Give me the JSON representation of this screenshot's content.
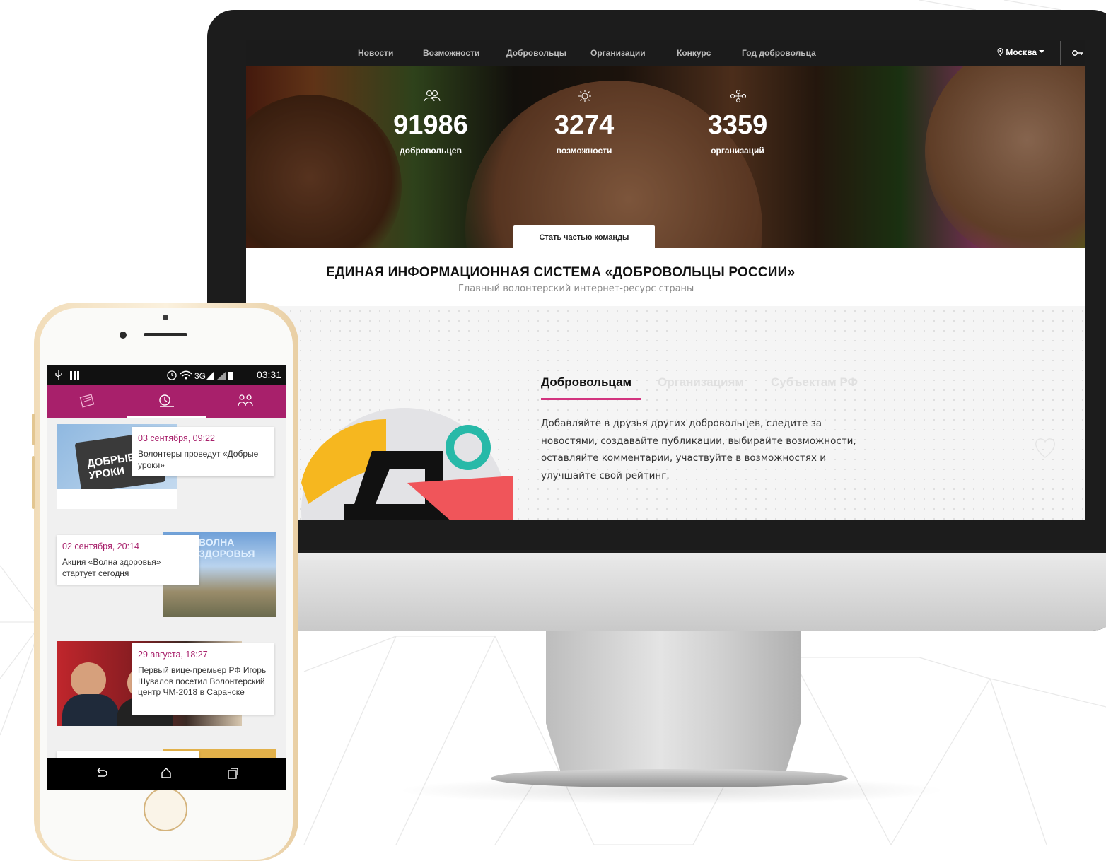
{
  "desktop": {
    "nav": {
      "items": [
        "Новости",
        "Возможности",
        "Добровольцы",
        "Организации",
        "Конкурс",
        "Год добровольца"
      ],
      "city": "Москва",
      "icons": [
        "location-pin-icon",
        "key-icon"
      ]
    },
    "hero": {
      "stats": [
        {
          "value": "91986",
          "label": "добровольцев",
          "icon": "people-icon"
        },
        {
          "value": "3274",
          "label": "возможности",
          "icon": "sun-icon"
        },
        {
          "value": "3359",
          "label": "организаций",
          "icon": "network-icon"
        }
      ],
      "cta": "Стать частью команды"
    },
    "title": "ЕДИНАЯ ИНФОРМАЦИОННАЯ СИСТЕМА «ДОБРОВОЛЬЦЫ РОССИИ»",
    "subtitle": "Главный волонтерский интернет-ресурс страны",
    "tabs": [
      {
        "label": "Добровольцам",
        "active": true
      },
      {
        "label": "Организациям",
        "active": false
      },
      {
        "label": "Субъектам РФ",
        "active": false
      }
    ],
    "description": "Добавляйте в друзья других добровольцев, следите за новостями, создавайте публикации, выбирайте возможности, оставляйте комментарии, участвуйте в возможностях и улучшайте свой рейтинг.",
    "accent_color": "#d2347f"
  },
  "phone": {
    "status": {
      "network": "3G",
      "time": "03:31"
    },
    "tabs": [
      "news-icon",
      "opportunities-icon",
      "people-icon"
    ],
    "accent_color": "#a8206b",
    "news": [
      {
        "date": "03 сентября, 09:22",
        "text": "Волонтеры проведут «Добрые уроки»",
        "image_text": "ДОБРЫЕ УРОКИ"
      },
      {
        "date": "02 сентября, 20:14",
        "text": "Акция «Волна здоровья» стартует сегодня",
        "image_text": "ВОЛНА ЗДОРОВЬЯ"
      },
      {
        "date": "29 августа, 18:27",
        "text": "Первый вице-премьер РФ Игорь Шувалов посетил Волонтерский центр ЧМ-2018 в Саранске",
        "image_text": ""
      }
    ],
    "navbar": [
      "back-icon",
      "home-icon",
      "recents-icon"
    ]
  }
}
